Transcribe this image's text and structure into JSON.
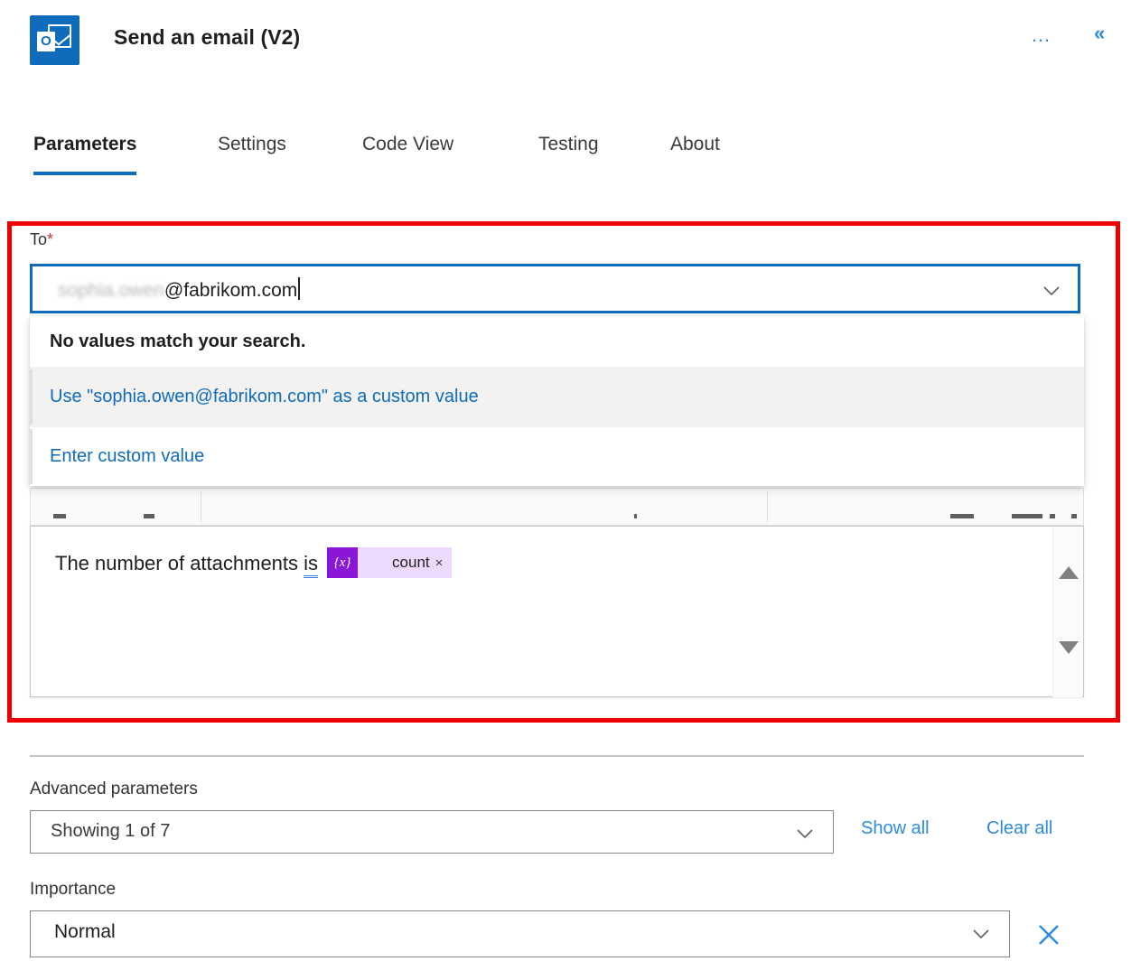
{
  "header": {
    "app_icon": "outlook-icon",
    "app_icon_letter": "O",
    "title": "Send an email (V2)",
    "more_label": "…",
    "collapse_label": "«",
    "accent_color": "#0f6cbd",
    "link_color": "#2d8ae0"
  },
  "tabs": [
    {
      "label": "Parameters",
      "active": true
    },
    {
      "label": "Settings",
      "active": false
    },
    {
      "label": "Code View",
      "active": false
    },
    {
      "label": "Testing",
      "active": false
    },
    {
      "label": "About",
      "active": false
    }
  ],
  "annotation": {
    "color": "#ee0000",
    "note": "red-highlight-box"
  },
  "to_field": {
    "label": "To",
    "required_marker": "*",
    "required_color": "#d13438",
    "value_blurred": "sophia.owen",
    "value_visible": "@fabrikom.com",
    "full_value": "sophia.owen@fabrikom.com",
    "chevron": "chevron-down-icon"
  },
  "dropdown": {
    "heading": "No values match your search.",
    "items": [
      {
        "label": "Use \"sophia.owen@fabrikom.com\" as a custom value",
        "highlighted": true
      },
      {
        "label": "Enter custom value",
        "highlighted": false
      }
    ]
  },
  "body_editor": {
    "text_prefix": "The number of attachments ",
    "grammar_word": "is",
    "token_icon": "{x}",
    "token_label": "count",
    "token_close": "×",
    "token_icon_color": "#8a17d8",
    "token_bg_color": "#ecd9fb",
    "scroll_up": "scroll-up-arrow",
    "scroll_down": "scroll-down-arrow"
  },
  "advanced": {
    "label": "Advanced parameters",
    "select_value": "Showing 1 of 7",
    "show_all": "Show all",
    "clear_all": "Clear all"
  },
  "importance": {
    "label": "Importance",
    "value": "Normal",
    "clear_icon": "close-icon"
  }
}
